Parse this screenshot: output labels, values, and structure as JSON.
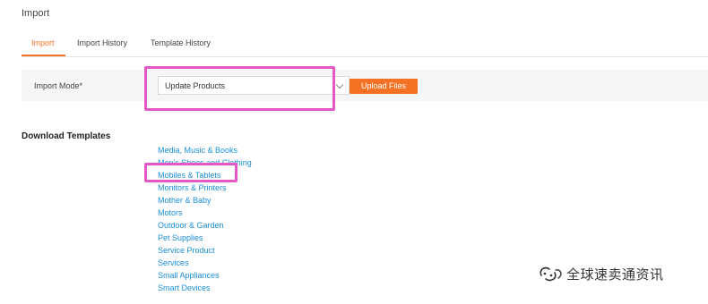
{
  "page": {
    "title": "Import"
  },
  "tabs": [
    {
      "label": "Import",
      "active": true
    },
    {
      "label": "Import History",
      "active": false
    },
    {
      "label": "Template History",
      "active": false
    }
  ],
  "import_mode": {
    "label": "Import Mode*",
    "selected": "Update Products"
  },
  "upload_button": {
    "label": "Upload Files"
  },
  "download_templates": {
    "title": "Download Templates",
    "items": [
      "Media, Music & Books",
      "Men's Shoes and Clothing",
      "Mobiles & Tablets",
      "Monitors & Printers",
      "Mother & Baby",
      "Motors",
      "Outdoor & Garden",
      "Pet Supplies",
      "Service Product",
      "Services",
      "Small Appliances",
      "Smart Devices"
    ]
  },
  "watermark": {
    "text": "全球速卖通资讯",
    "icon": "wechat-icon"
  },
  "colors": {
    "accent": "#f57224",
    "link": "#1a8fd8",
    "highlight": "#e357c6",
    "row_background": "#f5f6f8"
  }
}
